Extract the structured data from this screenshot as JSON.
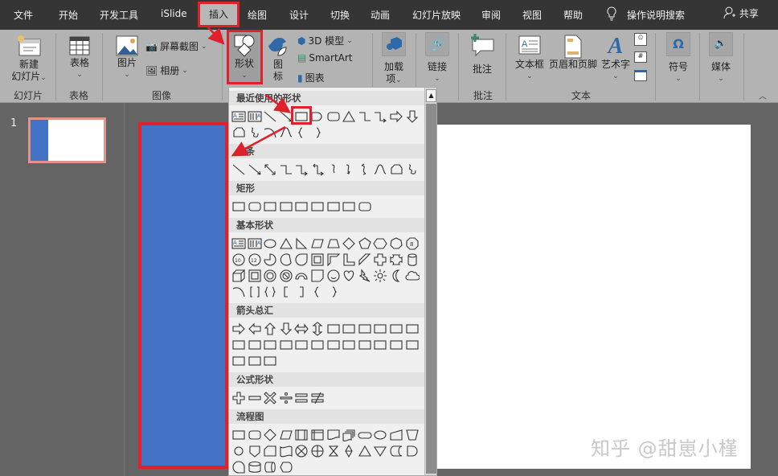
{
  "tabs": [
    "文件",
    "开始",
    "开发工具",
    "iSlide",
    "插入",
    "绘图",
    "设计",
    "切换",
    "动画",
    "幻灯片放映",
    "审阅",
    "视图",
    "帮助"
  ],
  "active_tab": "插入",
  "tell_me": "操作说明搜索",
  "share": "共享",
  "ribbon": {
    "new_slide": [
      "新建",
      "幻灯片"
    ],
    "group_slides": "幻灯片",
    "table": "表格",
    "group_table": "表格",
    "picture": "图片",
    "screenshot": "屏幕截图",
    "album": "相册",
    "group_images": "图像",
    "shapes": "形状",
    "icons": [
      "图",
      "标"
    ],
    "model3d": "3D 模型",
    "smartart": "SmartArt",
    "chart": "图表",
    "addins": [
      "加载",
      "项"
    ],
    "link": "链接",
    "comment": "批注",
    "group_comments": "批注",
    "textbox": "文本框",
    "header_footer": "页眉和页脚",
    "wordart": "艺术字",
    "group_text": "文本",
    "symbol": "符号",
    "media": "媒体"
  },
  "slides": {
    "number": "1"
  },
  "watermark": "知乎 @甜崽小槿",
  "accent": "#4472c4",
  "annotation_color": "#e0202a",
  "gallery": {
    "sections": [
      {
        "title": "最近使用的形状",
        "rows": [
          [
            "textbox",
            "vtextbox",
            "line",
            "arrow-line",
            "rect",
            "ellipse-half",
            "round-rect",
            "triangle",
            "elbow",
            "elbow-arrow",
            "arrow-right",
            "arrow-down"
          ],
          [
            "freeform",
            "scribble",
            "arc",
            "curve",
            "brace-l",
            "brace-r"
          ]
        ]
      },
      {
        "title": "线条",
        "rows": [
          [
            "line",
            "arrow-line",
            "double-arrow",
            "elbow",
            "elbow-arrow",
            "elbow-double",
            "curve-s",
            "curve-arrow",
            "curve-double",
            "curve",
            "freeform",
            "scribble"
          ]
        ]
      },
      {
        "title": "矩形",
        "rows": [
          [
            "rect",
            "round-rect",
            "snip-rect",
            "snip2",
            "snip3",
            "round1",
            "round2",
            "round3",
            "round-rect"
          ]
        ]
      },
      {
        "title": "基本形状",
        "rows": [
          [
            "textbox",
            "vtextbox",
            "ellipse",
            "triangle",
            "rtriangle",
            "parallelogram",
            "trapezoid",
            "diamond",
            "pentagon",
            "hexagon",
            "heptagon",
            "octagon"
          ],
          [
            "decagon",
            "dodecagon",
            "pie",
            "chord",
            "teardrop",
            "frame",
            "half-frame",
            "l-shape",
            "diag-stripe",
            "cross",
            "plaque",
            "can"
          ],
          [
            "cube",
            "bevel",
            "donut",
            "no-symbol",
            "block-arc",
            "folded",
            "smiley",
            "heart",
            "lightning",
            "sun",
            "moon",
            "cloud"
          ],
          [
            "arc",
            "bracket-pair",
            "brace-pair",
            "bracket-l",
            "bracket-r",
            "brace-l",
            "brace-r"
          ]
        ]
      },
      {
        "title": "箭头总汇",
        "rows": [
          [
            "arrow-right",
            "arrow-left",
            "arrow-up",
            "arrow-down",
            "arrow-lr",
            "arrow-ud",
            "arrow-quad",
            "arrow-lru",
            "arrow-bent",
            "arrow-uturn",
            "arrow-lup",
            "arrow-bentup"
          ],
          [
            "arrow-curve-r",
            "arrow-curve-l",
            "arrow-curve-u",
            "arrow-curve-d",
            "arrow-striped",
            "arrow-notched",
            "pentagon-arrow",
            "chevron",
            "callout-r",
            "callout-d",
            "callout-l",
            "callout-u"
          ],
          [
            "callout-lr",
            "callout-quad",
            "arrow-circular"
          ]
        ]
      },
      {
        "title": "公式形状",
        "rows": [
          [
            "plus",
            "minus",
            "multiply",
            "divide",
            "equal",
            "not-equal"
          ]
        ]
      },
      {
        "title": "流程图",
        "rows": [
          [
            "rect",
            "round-rect",
            "diamond",
            "parallelogram",
            "predefined",
            "internal",
            "document",
            "multidoc",
            "terminator",
            "ellipse",
            "manual-input",
            "manual-op"
          ],
          [
            "connector",
            "offpage",
            "card",
            "tape",
            "sum",
            "or",
            "collate",
            "sort",
            "triangle",
            "down-triangle",
            "stored-data",
            "delay"
          ],
          [
            "seq-access",
            "disk",
            "direct-access",
            "display"
          ]
        ]
      },
      {
        "title": "星与旗帜",
        "rows": []
      }
    ]
  }
}
